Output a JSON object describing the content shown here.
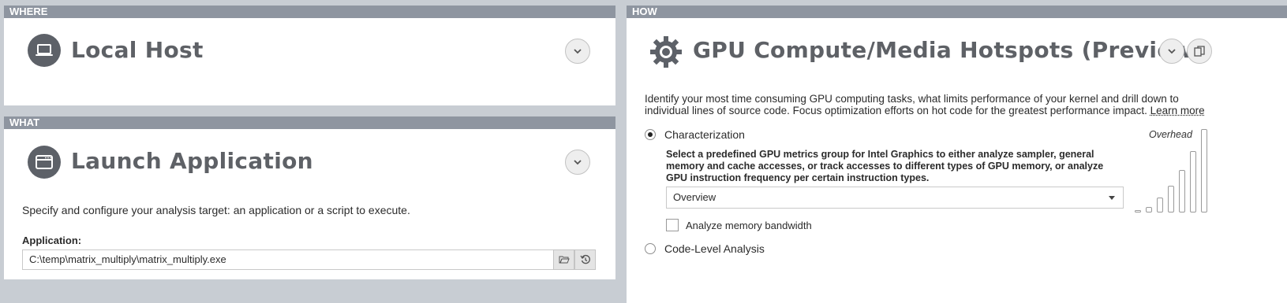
{
  "where": {
    "header": "WHERE",
    "title": "Local Host",
    "icon": "laptop-icon"
  },
  "what": {
    "header": "WHAT",
    "title": "Launch Application",
    "icon": "application-window-icon",
    "description": "Specify and configure your analysis target: an application or a script to execute.",
    "application_label": "Application:",
    "application_value": "C:\\temp\\matrix_multiply\\matrix_multiply.exe"
  },
  "how": {
    "header": "HOW",
    "title": "GPU Compute/Media Hotspots (Preview)",
    "icon": "gear-icon",
    "description_line1": "Identify your most time consuming GPU computing tasks, what limits performance of your kernel and drill down to",
    "description_line2": "individual lines of source code. Focus optimization efforts on hot code for the greatest performance impact.",
    "learn_more": "Learn more",
    "options": {
      "characterization_label": "Characterization",
      "characterization_selected": true,
      "characterization_desc": [
        "Select a predefined GPU metrics group for Intel Graphics to either analyze sampler, general",
        "memory and cache accesses, or track accesses to different types of GPU memory, or analyze",
        "GPU instruction frequency per certain instruction types."
      ],
      "metrics_group_value": "Overview",
      "analyze_memory_label": "Analyze memory bandwidth",
      "analyze_memory_checked": false,
      "code_level_label": "Code-Level Analysis",
      "code_level_selected": false
    },
    "overhead_label": "Overhead",
    "overhead_levels": [
      1,
      2,
      3,
      4,
      5,
      6,
      7
    ]
  },
  "colors": {
    "header_bar": "#8e95a0",
    "icon_circle": "#5d6168",
    "title_text": "#5e6166"
  }
}
